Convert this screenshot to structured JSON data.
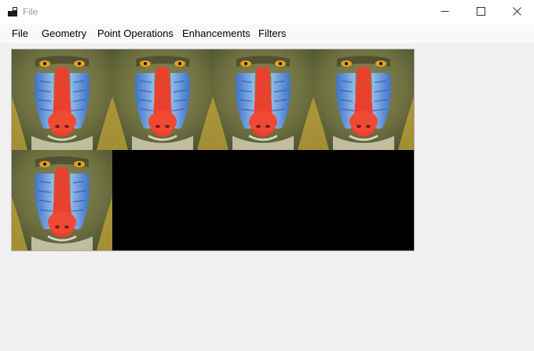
{
  "window": {
    "title": "File",
    "icon": "app-window-icon",
    "controls": [
      "minimize-icon",
      "maximize-icon",
      "close-icon"
    ]
  },
  "menu": {
    "items": [
      {
        "label": "File"
      },
      {
        "label": "Geometry"
      },
      {
        "label": "Point Operations"
      },
      {
        "label": "Enhancements"
      },
      {
        "label": "Filters"
      }
    ]
  },
  "canvas": {
    "background": "#000000",
    "image_count": 5,
    "image_subject": "mandrill"
  },
  "colors": {
    "titlebar": "#ffffff",
    "menubar": "#f9f9f9",
    "window_bg": "#f0f0f0"
  }
}
